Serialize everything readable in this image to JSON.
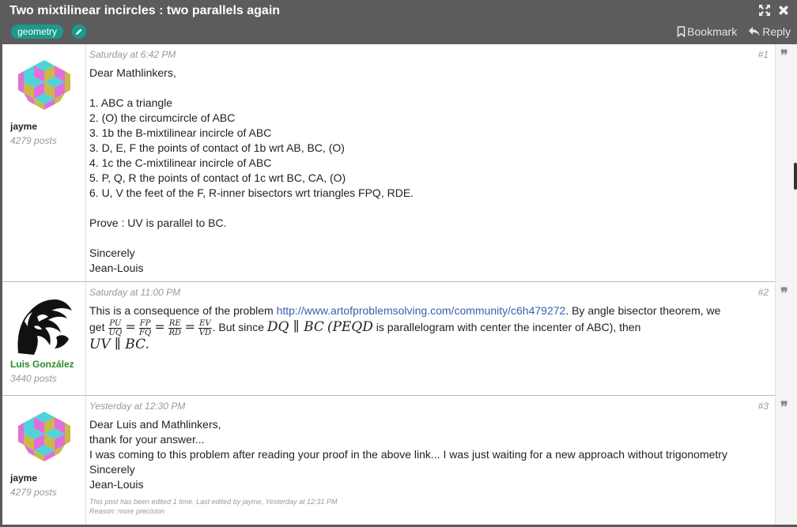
{
  "topic": {
    "title": "Two mixtilinear incircles : two parallels again",
    "tag": "geometry",
    "bookmark_label": "Bookmark",
    "reply_label": "Reply"
  },
  "posts": [
    {
      "username": "jayme",
      "post_count": "4279 posts",
      "timestamp": "Saturday at 6:42 PM",
      "number": "#1",
      "lines": [
        "Dear Mathlinkers,",
        "1. ABC a triangle",
        "2. (O) the circumcircle of ABC",
        "3. 1b the B-mixtilinear incircle of ABC",
        "3. D, E, F the points of contact of 1b wrt AB, BC, (O)",
        "4. 1c the C-mixtilinear incircle of ABC",
        "5. P, Q, R the points of contact of 1c wrt BC, CA, (O)",
        "6. U, V the feet of the F, R-inner bisectors wrt triangles FPQ, RDE.",
        "Prove : UV is parallel to BC.",
        "Sincerely",
        "Jean-Louis"
      ]
    },
    {
      "username": "Luis González",
      "post_count": "3440 posts",
      "timestamp": "Saturday at 11:00 PM",
      "number": "#2",
      "text_a": "This is a consequence of the problem ",
      "link": "http://www.artofproblemsolving.com/community/c6h479272",
      "text_b": ". By angle bisector theorem, we",
      "text_c": "get ",
      "math_fracs": [
        {
          "num": "PU",
          "den": "UQ"
        },
        {
          "num": "FP",
          "den": "FQ"
        },
        {
          "num": "RE",
          "den": "RD"
        },
        {
          "num": "EV",
          "den": "VD"
        }
      ],
      "text_d": ". But since ",
      "math_par1": "DQ ∥ BC",
      "math_par2": "(PEQD",
      "text_e": " is parallelogram with center the incenter of ABC), then",
      "math_par3": "UV ∥ BC."
    },
    {
      "username": "jayme",
      "post_count": "4279 posts",
      "timestamp": "Yesterday at 12:30 PM",
      "number": "#3",
      "lines": [
        "Dear Luis and Mathlinkers,",
        "thank for your answer...",
        "I was coming to this problem after reading your proof in the above link... I was just waiting for a new approach without trigonometry",
        "Sincerely",
        "Jean-Louis"
      ],
      "edit_note": "This post has been edited 1 time. Last edited by jayme, Yesterday at 12:31 PM",
      "edit_reason": "Reason: more precision"
    }
  ],
  "colors": {
    "header_bg": "#5c5c5c",
    "tag_bg": "#1b9a8e",
    "link": "#3a5fae",
    "luis_name": "#2a8a2a"
  },
  "icons": {
    "expand": "expand-icon",
    "close": "close-icon",
    "bookmark": "bookmark-icon",
    "reply": "reply-icon",
    "pencil": "pencil-icon",
    "quote": "quote-icon"
  }
}
